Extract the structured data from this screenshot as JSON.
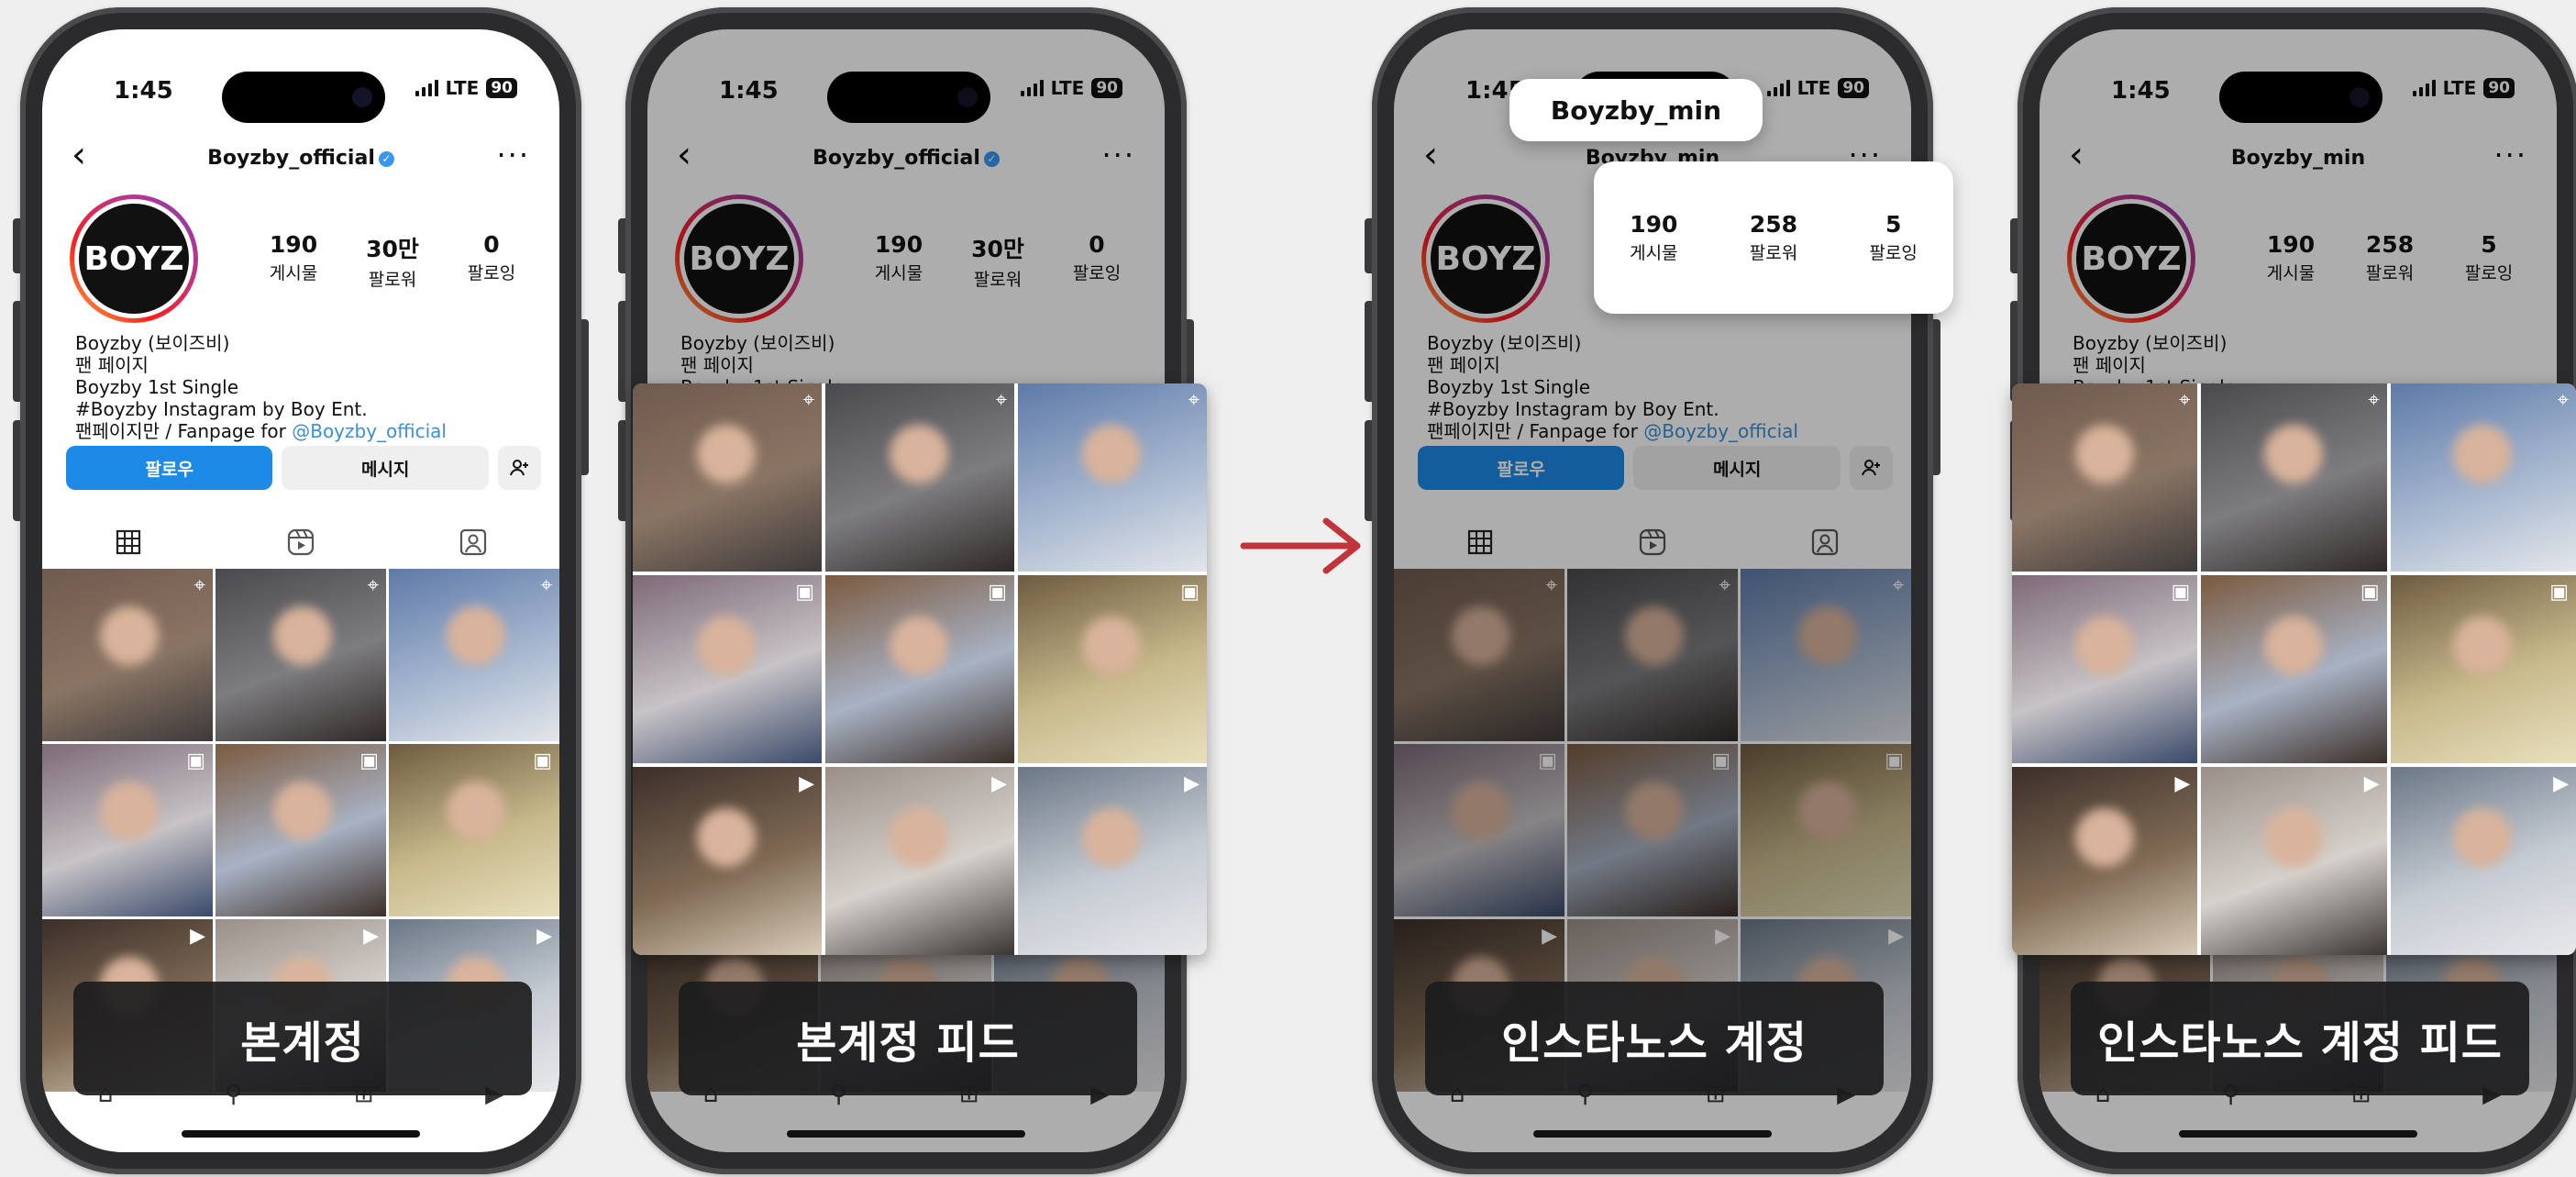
{
  "status": {
    "time": "1:45",
    "network": "LTE",
    "battery": "90"
  },
  "captions": [
    "본계정",
    "본계정 피드",
    "인스타노스 계정",
    "인스타노스 계정 피드"
  ],
  "main_account": {
    "handle": "Boyzby_official",
    "avatar_text": "BOYZ",
    "stats": [
      {
        "value": "190",
        "label": "게시물"
      },
      {
        "value": "30만",
        "label": "팔로워"
      },
      {
        "value": "0",
        "label": "팔로잉"
      }
    ],
    "bio": {
      "line1": "Boyzby (보이즈비)",
      "line2": "팬 페이지",
      "line3": "Boyzby 1st Single",
      "line4": "#Boyzby Instagram by Boy Ent.",
      "line5_prefix": "팬페이지만 / Fanpage for ",
      "line5_mention": "@Boyzby_official"
    },
    "buttons": {
      "follow": "팔로우",
      "message": "메시지"
    }
  },
  "fake_account": {
    "handle": "Boyzby_min",
    "avatar_text": "BOYZ",
    "stats": [
      {
        "value": "190",
        "label": "게시물"
      },
      {
        "value": "258",
        "label": "팔로워"
      },
      {
        "value": "5",
        "label": "팔로잉"
      }
    ],
    "bio": {
      "line1": "Boyzby (보이즈비)",
      "line2": "팬 페이지",
      "line3": "Boyzby 1st Single",
      "line4": "#Boyzby Instagram by Boy Ent.",
      "line5_prefix": "팬페이지만 / Fanpage for ",
      "line5_mention": "@Boyzby_official"
    },
    "buttons": {
      "follow": "팔로우",
      "message": "메시지"
    }
  },
  "icons": {
    "back": "chevron-left-icon",
    "more": "more-icon",
    "verified": "verified-badge-icon",
    "grid_tab": "grid-icon",
    "reels_tab": "reels-icon",
    "tagged_tab": "tagged-icon",
    "add_friend": "add-person-icon",
    "pin": "pin-icon",
    "arrow": "arrow-right-icon"
  },
  "colors": {
    "follow_button": "#1c8ae6",
    "mention": "#3a8fd6",
    "arrow": "#c0343b",
    "caption_bg": "#1c1c1e"
  }
}
